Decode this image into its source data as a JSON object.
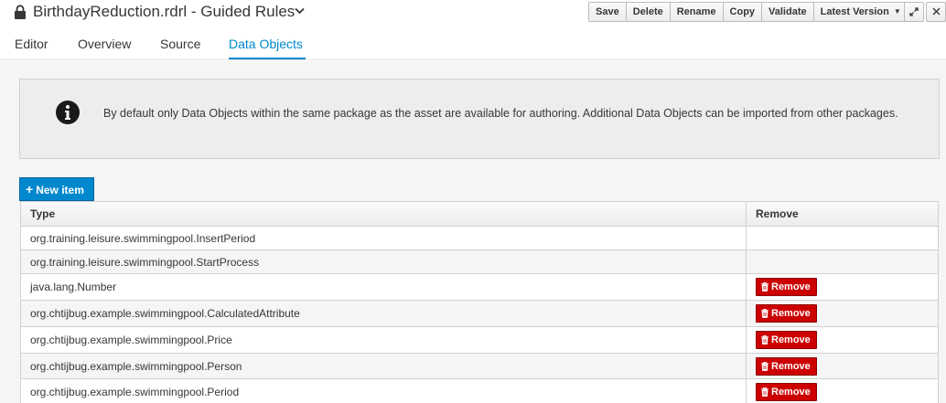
{
  "header": {
    "title": "BirthdayReduction.rdrl - Guided Rules",
    "lock_icon": "lock-icon",
    "caret_icon": "chevron-down-icon",
    "toolbar": {
      "save": "Save",
      "delete": "Delete",
      "rename": "Rename",
      "copy": "Copy",
      "validate": "Validate",
      "version": "Latest Version"
    },
    "expand_icon": "expand-icon",
    "close_icon": "close-icon"
  },
  "tabs": [
    {
      "label": "Editor",
      "active": false
    },
    {
      "label": "Overview",
      "active": false
    },
    {
      "label": "Source",
      "active": false
    },
    {
      "label": "Data Objects",
      "active": true
    }
  ],
  "alert": {
    "icon": "info-icon",
    "text": "By default only Data Objects within the same package as the asset are available for authoring. Additional Data Objects can be imported from other packages."
  },
  "new_item_button": "New item",
  "table": {
    "columns": {
      "type": "Type",
      "remove": "Remove"
    },
    "rows": [
      {
        "type": "org.training.leisure.swimmingpool.InsertPeriod",
        "remove": ""
      },
      {
        "type": "org.training.leisure.swimmingpool.StartProcess",
        "remove": ""
      },
      {
        "type": "java.lang.Number",
        "remove": "Remove"
      },
      {
        "type": "org.chtijbug.example.swimmingpool.CalculatedAttribute",
        "remove": "Remove"
      },
      {
        "type": "org.chtijbug.example.swimmingpool.Price",
        "remove": "Remove"
      },
      {
        "type": "org.chtijbug.example.swimmingpool.Person",
        "remove": "Remove"
      },
      {
        "type": "org.chtijbug.example.swimmingpool.Period",
        "remove": "Remove"
      }
    ]
  },
  "colors": {
    "accent": "#0088ce",
    "danger": "#cc0000"
  }
}
